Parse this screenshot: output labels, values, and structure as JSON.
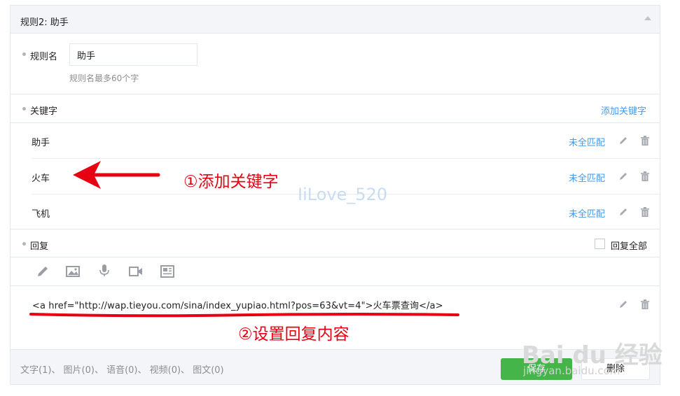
{
  "panel": {
    "title": "规则2: 助手"
  },
  "rule_name": {
    "label": "规则名",
    "value": "助手",
    "hint": "规则名最多60个字"
  },
  "keywords": {
    "label": "关键字",
    "add_link": "添加关键字",
    "items": [
      {
        "text": "助手",
        "match": "未全匹配"
      },
      {
        "text": "火车",
        "match": "未全匹配"
      },
      {
        "text": "飞机",
        "match": "未全匹配"
      }
    ]
  },
  "reply": {
    "label": "回复",
    "reply_all": "回复全部",
    "toolbar_icons": [
      "pencil-icon",
      "image-icon",
      "microphone-icon",
      "video-icon",
      "news-icon"
    ],
    "content": "<a href=\"http://wap.tieyou.com/sina/index_yupiao.html?pos=63&vt=4\">火车票查询</a>"
  },
  "footer": {
    "counts": "文字(1)、 图片(0)、 语音(0)、 视频(0)、 图文(0)",
    "save_label": "保存",
    "delete_label": "删除"
  },
  "annotations": {
    "step1": "①添加关键字",
    "step2": "②设置回复内容"
  },
  "watermarks": {
    "center": "IiLove_520",
    "baidu": "Bai du 经验",
    "baidu_sub": "jingyan.baidu.com"
  },
  "colors": {
    "accent_link": "#459ae9",
    "save_green": "#44b549",
    "annotation_red": "#e60012"
  }
}
